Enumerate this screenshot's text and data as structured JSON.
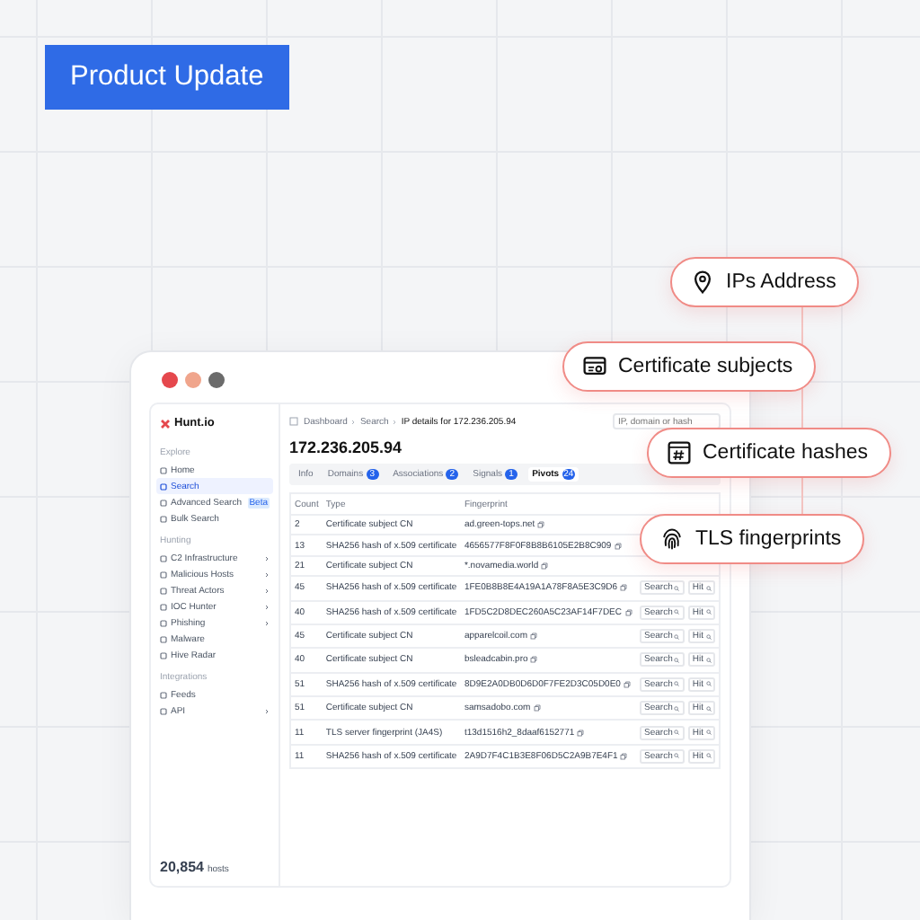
{
  "badge": "Product Update",
  "window": {
    "dots": [
      {
        "color": "#e5484d"
      },
      {
        "color": "#f0a58c"
      },
      {
        "color": "#6b6b6b"
      }
    ]
  },
  "sidebar": {
    "logo": "Hunt.io",
    "sections": [
      {
        "title": "Explore",
        "items": [
          {
            "label": "Home",
            "selected": false
          },
          {
            "label": "Search",
            "selected": true
          },
          {
            "label": "Advanced Search",
            "selected": false,
            "badge": "Beta"
          },
          {
            "label": "Bulk Search",
            "selected": false
          }
        ]
      },
      {
        "title": "Hunting",
        "items": [
          {
            "label": "C2 Infrastructure",
            "selected": false,
            "expandable": true
          },
          {
            "label": "Malicious Hosts",
            "selected": false,
            "expandable": true
          },
          {
            "label": "Threat Actors",
            "selected": false,
            "expandable": true
          },
          {
            "label": "IOC Hunter",
            "selected": false,
            "expandable": true
          },
          {
            "label": "Phishing",
            "selected": false,
            "expandable": true
          },
          {
            "label": "Malware",
            "selected": false
          },
          {
            "label": "Hive Radar",
            "selected": false
          }
        ]
      },
      {
        "title": "Integrations",
        "items": [
          {
            "label": "Feeds",
            "selected": false
          },
          {
            "label": "API",
            "selected": false,
            "expandable": true
          }
        ]
      }
    ],
    "footer_count": "20,854",
    "footer_label": "hosts"
  },
  "main": {
    "breadcrumb": [
      "Dashboard",
      "Search",
      "IP details for 172.236.205.94"
    ],
    "search_placeholder": "IP, domain or hash",
    "title": "172.236.205.94",
    "tabs": [
      {
        "label": "Info",
        "selected": false
      },
      {
        "label": "Domains",
        "count": "3",
        "selected": false
      },
      {
        "label": "Associations",
        "count": "2",
        "selected": false
      },
      {
        "label": "Signals",
        "count": "1",
        "selected": false
      },
      {
        "label": "Pivots",
        "count": "24",
        "selected": true
      }
    ],
    "table": {
      "columns": [
        "Count",
        "Type",
        "Fingerprint"
      ],
      "rows": [
        {
          "count": "2",
          "type": "Certificate subject CN",
          "fingerprint": "ad.green-tops.net"
        },
        {
          "count": "13",
          "type": "SHA256 hash of x.509 certificate",
          "fingerprint": "4656577F8F0F8B8B6105E2B8C909"
        },
        {
          "count": "21",
          "type": "Certificate subject CN",
          "fingerprint": "*.novamedia.world"
        },
        {
          "count": "45",
          "type": "SHA256 hash of x.509 certificate",
          "fingerprint": "1FE0B8B8E4A19A1A78F8A5E3C9D6",
          "actions": [
            "Search",
            "Hit"
          ]
        },
        {
          "count": "40",
          "type": "SHA256 hash of x.509 certificate",
          "fingerprint": "1FD5C2D8DEC260A5C23AF14F7DEC",
          "actions": [
            "Search",
            "Hit"
          ]
        },
        {
          "count": "45",
          "type": "Certificate subject CN",
          "fingerprint": "apparelcoil.com",
          "actions": [
            "Search",
            "Hit"
          ]
        },
        {
          "count": "40",
          "type": "Certificate subject CN",
          "fingerprint": "bsleadcabin.pro",
          "actions": [
            "Search",
            "Hit"
          ]
        },
        {
          "count": "51",
          "type": "SHA256 hash of x.509 certificate",
          "fingerprint": "8D9E2A0DB0D6D0F7FE2D3C05D0E0",
          "actions": [
            "Search",
            "Hit"
          ]
        },
        {
          "count": "51",
          "type": "Certificate subject CN",
          "fingerprint": "samsadobo.com",
          "actions": [
            "Search",
            "Hit"
          ]
        },
        {
          "count": "11",
          "type": "TLS server fingerprint (JA4S)",
          "fingerprint": "t13d1516h2_8daaf6152771",
          "actions": [
            "Search",
            "Hit"
          ]
        },
        {
          "count": "11",
          "type": "SHA256 hash of x.509 certificate",
          "fingerprint": "2A9D7F4C1B3E8F06D5C2A9B7E4F1",
          "actions": [
            "Search",
            "Hit"
          ]
        }
      ]
    }
  },
  "callouts": [
    {
      "label": "IPs Address",
      "kind": "pin"
    },
    {
      "label": "Certificate subjects",
      "kind": "certificate"
    },
    {
      "label": "Certificate hashes",
      "kind": "hash"
    },
    {
      "label": "TLS fingerprints",
      "kind": "fingerprint"
    }
  ]
}
